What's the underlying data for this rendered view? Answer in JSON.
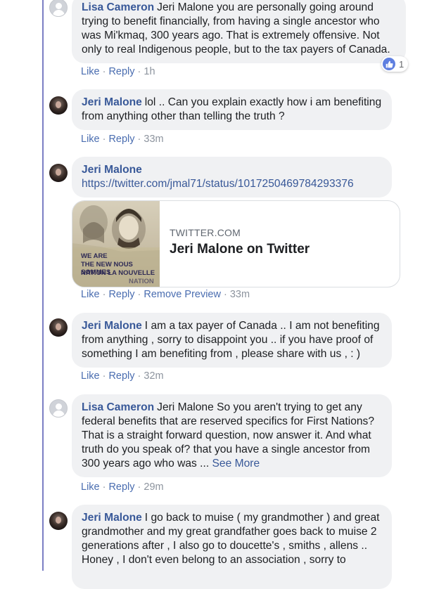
{
  "comments": [
    {
      "author": "Lisa Cameron",
      "text": "Jeri Malone you are personally going around trying to benefit financially, from having a single ancestor who was Mi'kmaq, 300 years ago. That is extremely offensive. Not only to real Indigenous people, but to the tax payers of Canada.",
      "actions": {
        "like": "Like",
        "reply": "Reply",
        "time": "1h"
      },
      "reaction": {
        "icon": "like-icon",
        "count": "1"
      }
    },
    {
      "author": "Jeri Malone",
      "text": "lol .. Can you explain exactly how i am benefiting from anything other than telling the truth ?",
      "actions": {
        "like": "Like",
        "reply": "Reply",
        "time": "33m"
      }
    },
    {
      "author": "Jeri Malone",
      "link": "https://twitter.com/jmal71/status/1017250469784293376",
      "preview": {
        "domain": "TWITTER.COM",
        "title": "Jeri Malone on Twitter",
        "poster_line1": "WE ARE",
        "poster_line2": "THE NEW NOUS SOMMES",
        "poster_line3": "NATION LA NOUVELLE",
        "poster_line4": "NATION"
      },
      "actions": {
        "like": "Like",
        "reply": "Reply",
        "remove": "Remove Preview",
        "time": "33m"
      }
    },
    {
      "author": "Jeri Malone",
      "text": "I am a tax payer of Canada .. I am not benefiting from anything , sorry to disappoint you .. if you have proof of something I am benefiting from , please share with us , : )",
      "actions": {
        "like": "Like",
        "reply": "Reply",
        "time": "32m"
      }
    },
    {
      "author": "Lisa Cameron",
      "text": "Jeri Malone So you aren't trying to get any federal benefits that are reserved specifics for First Nations? That is a straight forward question, now answer it. And what truth do you speak of? that you have a single ancestor from 300 years ago who was ...",
      "see_more": "See More",
      "actions": {
        "like": "Like",
        "reply": "Reply",
        "time": "29m"
      }
    },
    {
      "author": "Jeri Malone",
      "text": "I go back to muise ( my grandmother ) and great grandmother and my great grandfather goes back to muise 2 generations after , I also go to doucette's , smiths , allens .. Honey , I don't even belong to an association , sorry to"
    }
  ],
  "colors": {
    "author": "#385898",
    "bubble": "#f0f1f3",
    "thread_line": "#7b7fc4",
    "like_badge": "#5f7fe0"
  }
}
